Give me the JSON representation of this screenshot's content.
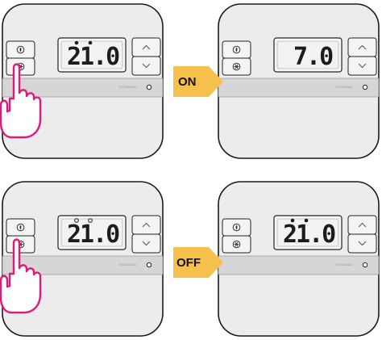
{
  "colors": {
    "device_fill": "#ececec",
    "device_stroke": "#1a1a1a",
    "band": "#d6d6d6",
    "arrow": "#f6c04d",
    "hand": "#e0197d"
  },
  "arrows": {
    "on_label": "ON",
    "off_label": "OFF"
  },
  "panels": {
    "top_left": {
      "display": "21.0",
      "frost_symbol": "two filled dots",
      "hand": true,
      "brand": "TECHNOMAG"
    },
    "top_right": {
      "display": "7.0",
      "frost_symbol": "none",
      "hand": false,
      "brand": "TECHNOMAG"
    },
    "bottom_left": {
      "display": "21.0",
      "frost_symbol": "two open dots",
      "hand": true,
      "brand": "TECHNOMAG"
    },
    "bottom_right": {
      "display": "21.0",
      "frost_symbol": "two filled dots",
      "hand": false,
      "brand": "TECHNOMAG"
    }
  },
  "icons": [
    "flame-icon",
    "snowflake-icon",
    "chevron-up-icon",
    "chevron-down-icon",
    "pointing-hand-icon"
  ]
}
